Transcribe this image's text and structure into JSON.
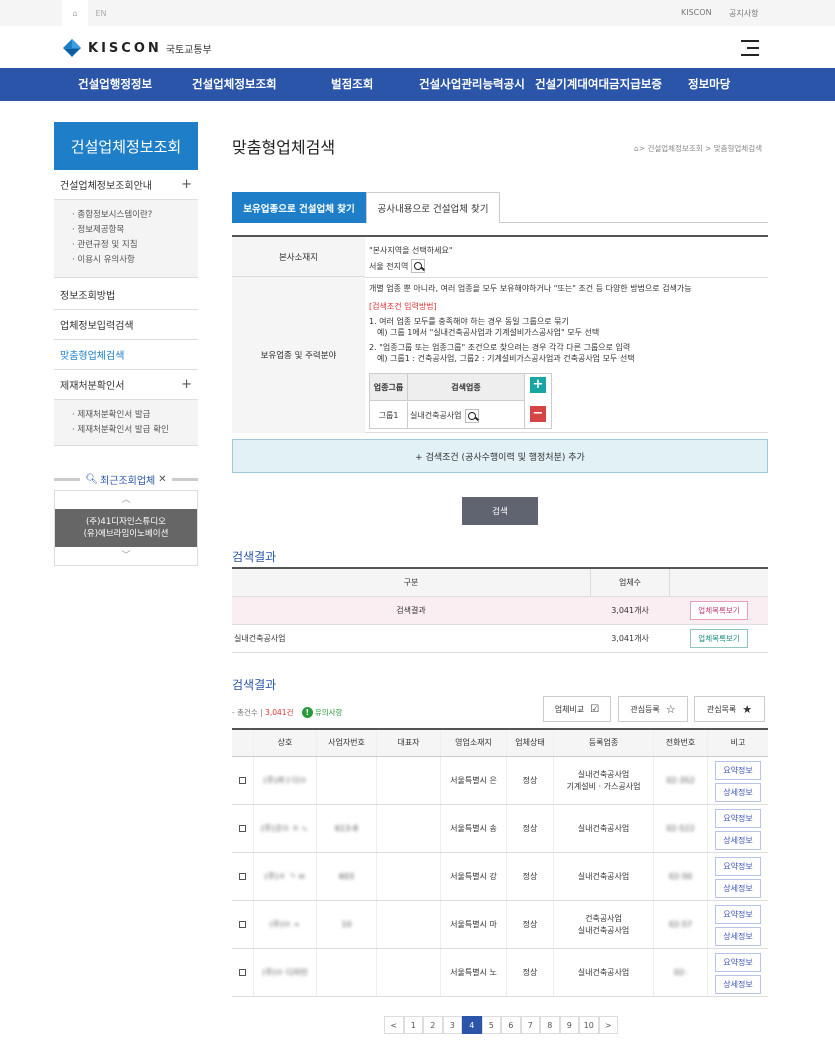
{
  "topbar": {
    "home_icon": "home-icon",
    "lang": "EN",
    "links": [
      "KISCON",
      "공지사항"
    ]
  },
  "header": {
    "brand": "KISCON",
    "ministry": "국토교통부",
    "menu_icon": "hamburger-icon"
  },
  "nav": [
    "건설업행정정보",
    "건설업체정보조회",
    "벌점조회",
    "건설사업관리능력공시",
    "건설기계대여대금지급보증",
    "정보마당"
  ],
  "sidebar": {
    "title": "건설업체정보조회",
    "items": [
      {
        "label": "건설업체정보조회안내",
        "expandable": true,
        "sub": [
          "종합정보시스템이란?",
          "정보제공항목",
          "관련규정 및 지침",
          "이용시 유의사항"
        ]
      },
      {
        "label": "정보조회방법"
      },
      {
        "label": "업체정보입력검색"
      },
      {
        "label": "맞춤형업체검색",
        "active": true
      },
      {
        "label": "제재처분확인서",
        "expandable": true,
        "sub": [
          "제재처분확인서 발급",
          "제재처분확인서 발급 확인"
        ]
      }
    ],
    "recent": {
      "title": "최근조회업체",
      "items": [
        "(주)41디자인스튜디오",
        "(유)에브라임이노베이션"
      ]
    }
  },
  "main": {
    "title": "맞춤형업체검색",
    "breadcrumb": [
      "건설업체정보조회",
      "맞춤형업체검색"
    ],
    "tabs": [
      "보유업종으로 건설업체 찾기",
      "공사내용으로 건설업체 찾기"
    ],
    "form": {
      "region_label": "본사소재지",
      "region_hint": "\"본사지역을 선택하세요\"",
      "region_value": "서울 전지역",
      "type_label": "보유업종 및 주력분야",
      "desc": "개별 업종 뿐 아니라, 여러 업종을 모두 보유해야하거나 \"또는\" 조건 등 다양한 방법으로 검색가능",
      "method_title": "[검색조건 입력방법]",
      "method_lines": [
        "1. 여러 업종 모두를 충족해야 하는 경우 동일 그룹으로 묶기",
        "예) 그룹 1에서 \"실내건축공사업과 기계설비가스공사업\" 모두 선택",
        "2. \"업종그룹 또는 업종그룹\" 조건으로 찾으려는 경우 각각 다른 그룹으로 입력",
        "예) 그룹1 : 건축공사업, 그룹2 : 기계설비가스공사업과 건축공사업 모두 선택"
      ],
      "group_headers": [
        "업종그룹",
        "검색업종"
      ],
      "group_row": {
        "group": "그룹1",
        "type": "실내건축공사업"
      }
    },
    "add_condition": "+ 검색조건 (공사수행이력 및 행정처분) 추가",
    "search_button": "검색",
    "summary": {
      "title": "검색결과",
      "headers": [
        "구분",
        "업체수",
        ""
      ],
      "rows": [
        {
          "label": "검색결과",
          "count": "3,041개사",
          "btn": "업체목록보기"
        },
        {
          "label": "실내건축공사업",
          "count": "3,041개사",
          "btn": "업체목록보기"
        }
      ]
    },
    "results": {
      "title": "검색결과",
      "total_label": "- 총건수 |",
      "total_count": "3,041건",
      "notice": "유의사항",
      "buttons": [
        "업체비교",
        "관심등록",
        "관심목록"
      ],
      "headers": [
        "",
        "상호",
        "사업자번호",
        "대표자",
        "영업소재지",
        "업체상태",
        "등록업종",
        "전화번호",
        "비고"
      ],
      "rows": [
        {
          "name": "(주)까ㅏ다ㅁ",
          "bizno": "",
          "ceo": "",
          "addr": "서울특별시 은",
          "status": "정상",
          "types": [
            "실내건축공사업",
            "기계설비 · 가스공사업"
          ],
          "tel": "02-352"
        },
        {
          "name": "(주)코ㅁ ㅈ ㄴ",
          "bizno": "613-8",
          "ceo": "",
          "addr": "서울특별시 송",
          "status": "정상",
          "types": [
            "실내건축공사업"
          ],
          "tel": "02-522"
        },
        {
          "name": "(주)ㅈ ㄱ ㅂ",
          "bizno": "603",
          "ceo": "",
          "addr": "서울특별시 강",
          "status": "정상",
          "types": [
            "실내건축공사업"
          ],
          "tel": "02-50"
        },
        {
          "name": "(주)ㅁ ㅅ",
          "bizno": "10",
          "ceo": "",
          "addr": "서울특별시 마",
          "status": "정상",
          "types": [
            "건축공사업",
            "실내건축공사업"
          ],
          "tel": "02-57"
        },
        {
          "name": "(주)ㅁ 디자인",
          "bizno": "",
          "ceo": "",
          "addr": "서울특별시 노",
          "status": "정상",
          "types": [
            "실내건축공사업"
          ],
          "tel": "02-"
        }
      ],
      "row_buttons": [
        "요약정보",
        "상세정보"
      ]
    },
    "pager": {
      "prev": "<",
      "pages": [
        "1",
        "2",
        "3",
        "4",
        "5",
        "6",
        "7",
        "8",
        "9",
        "10"
      ],
      "current": "4",
      "next": ">"
    }
  }
}
